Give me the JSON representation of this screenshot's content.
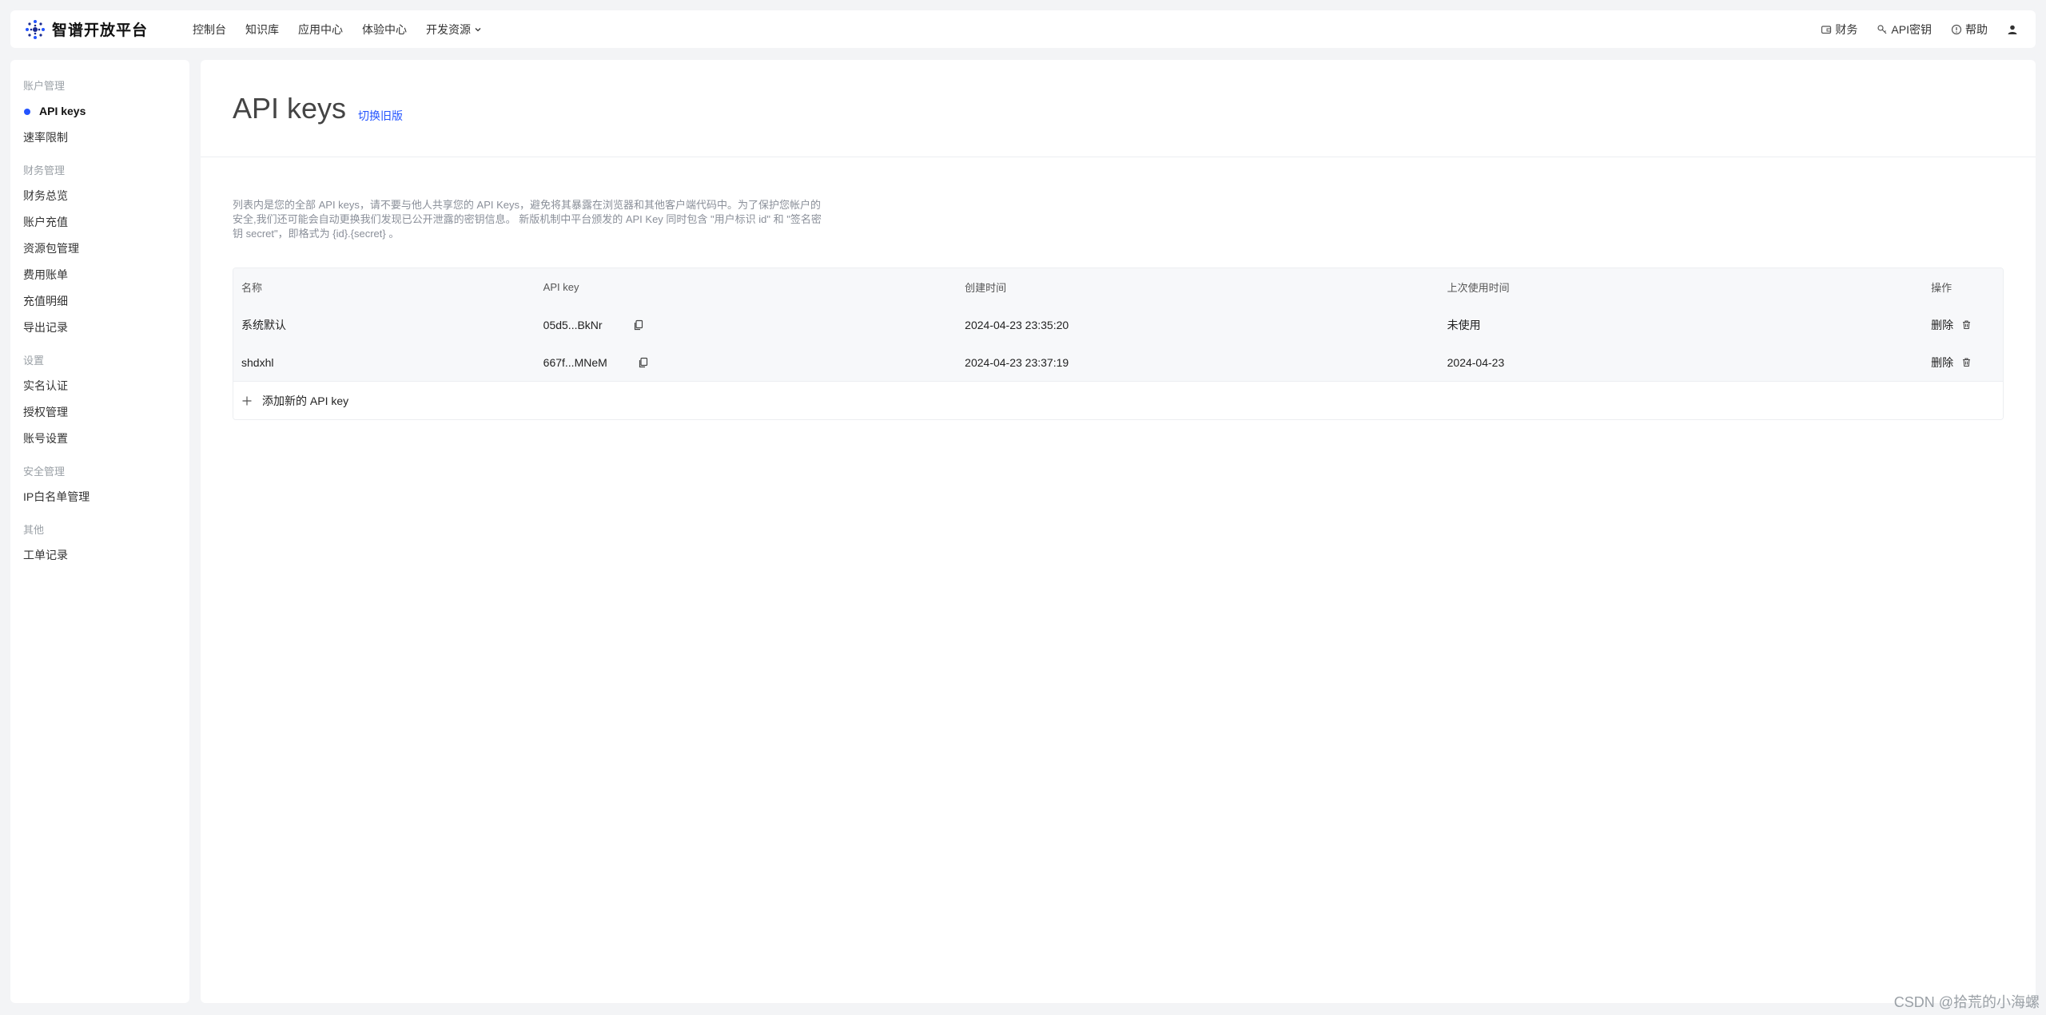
{
  "header": {
    "logo_text": "智谱开放平台",
    "nav": [
      {
        "label": "控制台"
      },
      {
        "label": "知识库"
      },
      {
        "label": "应用中心"
      },
      {
        "label": "体验中心"
      },
      {
        "label": "开发资源"
      }
    ],
    "right": {
      "finance": "财务",
      "api_key": "API密钥",
      "help": "帮助"
    }
  },
  "sidebar": {
    "groups": [
      {
        "title": "账户管理",
        "items": [
          {
            "label": "API keys"
          },
          {
            "label": "速率限制"
          }
        ]
      },
      {
        "title": "财务管理",
        "items": [
          {
            "label": "财务总览"
          },
          {
            "label": "账户充值"
          },
          {
            "label": "资源包管理"
          },
          {
            "label": "费用账单"
          },
          {
            "label": "充值明细"
          },
          {
            "label": "导出记录"
          }
        ]
      },
      {
        "title": "设置",
        "items": [
          {
            "label": "实名认证"
          },
          {
            "label": "授权管理"
          },
          {
            "label": "账号设置"
          }
        ]
      },
      {
        "title": "安全管理",
        "items": [
          {
            "label": "IP白名单管理"
          }
        ]
      },
      {
        "title": "其他",
        "items": [
          {
            "label": "工单记录"
          }
        ]
      }
    ]
  },
  "main": {
    "title": "API keys",
    "switch_link": "切换旧版",
    "description": "列表内是您的全部 API keys，请不要与他人共享您的 API Keys，避免将其暴露在浏览器和其他客户端代码中。为了保护您帐户的安全,我们还可能会自动更换我们发现已公开泄露的密钥信息。 新版机制中平台颁发的 API Key 同时包含 \"用户标识 id\" 和 \"签名密钥 secret\"，即格式为 {id}.{secret} 。",
    "table": {
      "headers": [
        "名称",
        "API key",
        "创建时间",
        "上次使用时间",
        "操作"
      ],
      "rows": [
        {
          "name": "系统默认",
          "key": "05d5...BkNr",
          "created": "2024-04-23 23:35:20",
          "last_used": "未使用",
          "action": "删除"
        },
        {
          "name": "shdxhl",
          "key": "667f...MNeM",
          "created": "2024-04-23 23:37:19",
          "last_used": "2024-04-23",
          "action": "删除"
        }
      ],
      "add_label": "添加新的 API key"
    }
  },
  "watermark": "CSDN @拾荒的小海螺",
  "colors": {
    "accent": "#2454ff",
    "muted": "#9aa0a6"
  }
}
